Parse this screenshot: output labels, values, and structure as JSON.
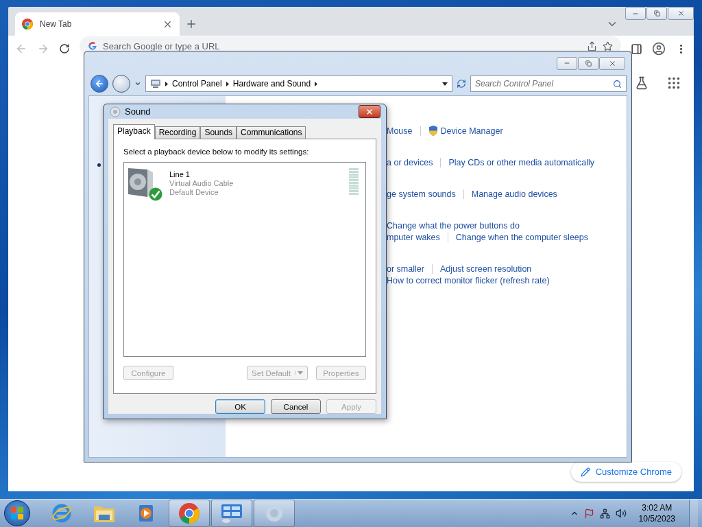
{
  "chrome": {
    "tabs": [
      {
        "title": "New Tab",
        "selected": true
      }
    ],
    "omnibox": {
      "placeholder": "Search Google or type a URL"
    },
    "customize_button": "Customize Chrome"
  },
  "control_panel": {
    "back_enabled": true,
    "breadcrumb": [
      "Control Panel",
      "Hardware and Sound"
    ],
    "search": {
      "placeholder": "Search Control Panel"
    },
    "link_groups": [
      [
        [
          {
            "text": "Mouse",
            "kind": "plain"
          },
          {
            "text": "Device Manager",
            "kind": "shield"
          }
        ]
      ],
      [
        [
          {
            "text": "a or devices",
            "kind": "plain"
          },
          {
            "text": "Play CDs or other media automatically",
            "kind": "plain"
          }
        ]
      ],
      [
        [
          {
            "text": "ge system sounds",
            "kind": "plain"
          },
          {
            "text": "Manage audio devices",
            "kind": "plain"
          }
        ]
      ],
      [
        [
          {
            "text": "Change what the power buttons do",
            "kind": "plain"
          }
        ],
        [
          {
            "text": "mputer wakes",
            "kind": "plain"
          },
          {
            "text": "Change when the computer sleeps",
            "kind": "plain"
          }
        ]
      ],
      [
        [
          {
            "text": "or smaller",
            "kind": "plain"
          },
          {
            "text": "Adjust screen resolution",
            "kind": "plain"
          }
        ],
        [
          {
            "text": "How to correct monitor flicker (refresh rate)",
            "kind": "plain"
          }
        ]
      ]
    ]
  },
  "sound_dialog": {
    "title": "Sound",
    "tabs": [
      {
        "label": "Playback",
        "selected": true
      },
      {
        "label": "Recording",
        "selected": false
      },
      {
        "label": "Sounds",
        "selected": false
      },
      {
        "label": "Communications",
        "selected": false
      }
    ],
    "instruction": "Select a playback device below to modify its settings:",
    "devices": [
      {
        "name": "Line 1",
        "driver": "Virtual Audio Cable",
        "status": "Default Device",
        "default": true,
        "selected": false
      }
    ],
    "device_buttons": [
      {
        "label": "Configure",
        "kind": "plain",
        "disabled": true
      },
      {
        "label": "Set Default",
        "kind": "split",
        "disabled": true
      },
      {
        "label": "Properties",
        "kind": "plain",
        "disabled": true
      }
    ],
    "footer_buttons": [
      {
        "label": "OK",
        "focused": true,
        "disabled": false
      },
      {
        "label": "Cancel",
        "focused": false,
        "disabled": false
      },
      {
        "label": "Apply",
        "focused": false,
        "disabled": true
      }
    ]
  },
  "taskbar": {
    "apps": [
      {
        "kind": "ie",
        "active": false
      },
      {
        "kind": "folder",
        "active": false
      },
      {
        "kind": "media",
        "active": false
      },
      {
        "kind": "chrome",
        "active": true
      },
      {
        "kind": "control-panel",
        "active": true
      },
      {
        "kind": "sound",
        "active": true
      }
    ],
    "clock": {
      "time": "3:02 AM",
      "date": "10/5/2023"
    }
  }
}
